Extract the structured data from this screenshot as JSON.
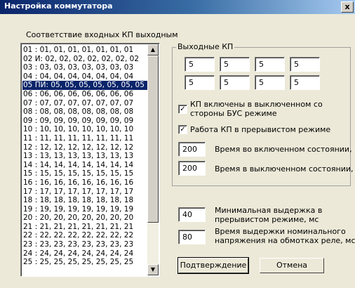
{
  "window": {
    "title": "Настройка коммутатора",
    "close_label": "x"
  },
  "mapping": {
    "heading": "Соответствие входных КП выходным",
    "items": [
      "01 : 01, 01, 01, 01, 01, 01, 01",
      "02 И: 02, 02, 02, 02, 02, 02, 02",
      "03 : 03, 03, 03, 03, 03, 03, 03",
      "04 : 04, 04, 04, 04, 04, 04, 04",
      "05 ПИ: 05, 05, 05, 05, 05, 05, 05",
      "06 : 06, 06, 06, 06, 06, 06, 06",
      "07 : 07, 07, 07, 07, 07, 07, 07",
      "08 : 08, 08, 08, 08, 08, 08, 08",
      "09 : 09, 09, 09, 09, 09, 09, 09",
      "10 : 10, 10, 10, 10, 10, 10, 10",
      "11 : 11, 11, 11, 11, 11, 11, 11",
      "12 : 12, 12, 12, 12, 12, 12, 12",
      "13 : 13, 13, 13, 13, 13, 13, 13",
      "14 : 14, 14, 14, 14, 14, 14, 14",
      "15 : 15, 15, 15, 15, 15, 15, 15",
      "16 : 16, 16, 16, 16, 16, 16, 16",
      "17 : 17, 17, 17, 17, 17, 17, 17",
      "18 : 18, 18, 18, 18, 18, 18, 18",
      "19 : 19, 19, 19, 19, 19, 19, 19",
      "20 : 20, 20, 20, 20, 20, 20, 20",
      "21 : 21, 21, 21, 21, 21, 21, 21",
      "22 : 22, 22, 22, 22, 22, 22, 22",
      "23 : 23, 23, 23, 23, 23, 23, 23",
      "24 : 24, 24, 24, 24, 24, 24, 24",
      "25 : 25, 25, 25, 25, 25, 25, 25"
    ],
    "selected_index": 4
  },
  "outputs": {
    "label": "Выходные КП",
    "row1": [
      "5",
      "5",
      "5",
      "5"
    ],
    "row2": [
      "5",
      "5",
      "5",
      "5"
    ]
  },
  "options": {
    "cb1_label_line1": "КП включены в выключенном со",
    "cb1_label_line2": "стороны БУС режиме",
    "cb1_checked": "✓",
    "cb2_label": "Работа КП в прерывистом режиме",
    "cb2_checked": "✓",
    "on_time_value": "200",
    "on_time_label": "Время во включенном состоянии, мс",
    "off_time_value": "200",
    "off_time_label": "Время в выключенном состоянии, мс"
  },
  "timing": {
    "min_delay_value": "40",
    "min_delay_line1": "Минимальная выдержка в",
    "min_delay_line2": "прерывистом режиме, мс",
    "nominal_value": "80",
    "nominal_line1": "Время выдержки номинального",
    "nominal_line2": "напряжения на обмотках реле, мс"
  },
  "buttons": {
    "confirm": "Подтверждение",
    "cancel": "Отмена"
  }
}
